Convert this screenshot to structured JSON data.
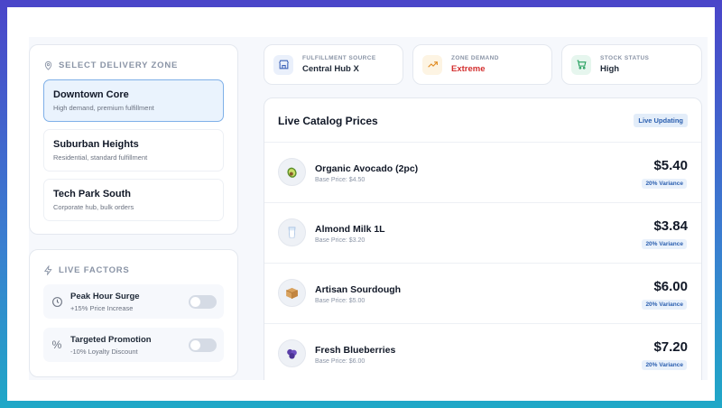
{
  "zones": {
    "title": "SELECT DELIVERY ZONE",
    "items": [
      {
        "name": "Downtown Core",
        "desc": "High demand, premium fulfillment"
      },
      {
        "name": "Suburban Heights",
        "desc": "Residential, standard fulfillment"
      },
      {
        "name": "Tech Park South",
        "desc": "Corporate hub, bulk orders"
      }
    ]
  },
  "factors": {
    "title": "LIVE FACTORS",
    "items": [
      {
        "title": "Peak Hour Surge",
        "sub": "+15% Price Increase"
      },
      {
        "title": "Targeted Promotion",
        "sub": "-10% Loyalty Discount"
      }
    ]
  },
  "stats": [
    {
      "label": "FULFILLMENT SOURCE",
      "value": "Central Hub X",
      "icon": "store-icon",
      "color": "#1f2937"
    },
    {
      "label": "ZONE DEMAND",
      "value": "Extreme",
      "icon": "trend-up-icon",
      "color": "#d32f2f"
    },
    {
      "label": "STOCK STATUS",
      "value": "High",
      "icon": "cart-icon",
      "color": "#1f2937"
    }
  ],
  "catalog": {
    "title": "Live Catalog Prices",
    "badge": "Live Updating",
    "items": [
      {
        "name": "Organic Avocado (2pc)",
        "base": "Base Price: $4.50",
        "price": "$5.40",
        "variance": "20% Variance",
        "icon": "avocado-icon"
      },
      {
        "name": "Almond Milk 1L",
        "base": "Base Price: $3.20",
        "price": "$3.84",
        "variance": "20% Variance",
        "icon": "milk-glass-icon"
      },
      {
        "name": "Artisan Sourdough",
        "base": "Base Price: $5.00",
        "price": "$6.00",
        "variance": "20% Variance",
        "icon": "package-icon"
      },
      {
        "name": "Fresh Blueberries",
        "base": "Base Price: $6.00",
        "price": "$7.20",
        "variance": "20% Variance",
        "icon": "blueberries-icon"
      }
    ]
  },
  "colors": {
    "accent": "#2b5fb0",
    "demand": "#d32f2f"
  }
}
